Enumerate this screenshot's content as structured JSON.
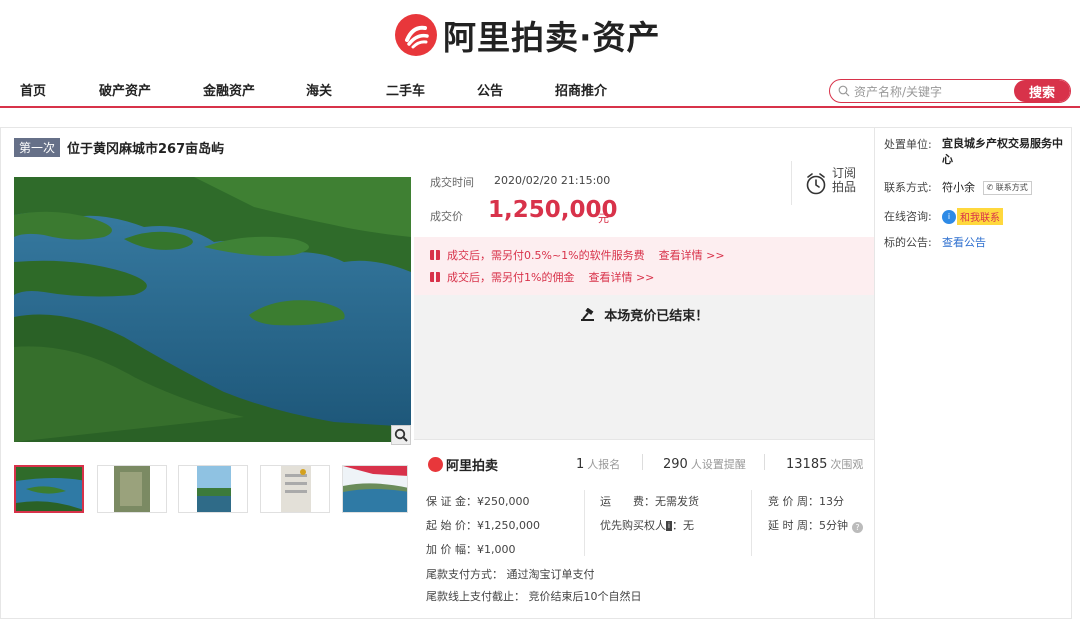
{
  "header": {
    "logo_text": "阿里拍卖·资产",
    "nav": [
      "首页",
      "破产资产",
      "金融资产",
      "海关",
      "二手车",
      "公告",
      "招商推介"
    ],
    "search_placeholder": "资产名称/关键字",
    "search_button": "搜索"
  },
  "item": {
    "round_tag": "第一次",
    "title": "位于黄冈麻城市267亩岛屿"
  },
  "deal": {
    "time_label": "成交时间",
    "time_value": "2020/02/20 21:15:00",
    "price_label": "成交价",
    "price_value": "1,250,000",
    "price_unit": "元",
    "subscribe_label": "订阅拍品",
    "notices": [
      {
        "text": "成交后，需另付0.5%~1%的软件服务费",
        "link": "查看详情 >>"
      },
      {
        "text": "成交后，需另付1%的佣金",
        "link": "查看详情 >>"
      }
    ],
    "ended_text": "本场竞价已结束！"
  },
  "stats": {
    "brand": "阿里拍卖",
    "signup_count": "1",
    "signup_label": "人报名",
    "reminder_count": "290",
    "reminder_label": "人设置提醒",
    "view_count": "13185",
    "view_label": "次围观"
  },
  "terms": {
    "deposit": "保 证 金：¥250,000",
    "start_price": "起 始 价：¥1,250,000",
    "increment": "加 价 幅：¥1,000",
    "shipping": "运　　费：无需发货",
    "priority": "优先购买权人",
    "priority_badge": "i",
    "priority_value": "：无",
    "bid_period": "竞 价 周：13分",
    "extend_period": "延 时 周：5分钟",
    "help_icon": "?",
    "final_pay_method": "尾款支付方式：  通过淘宝订单支付",
    "final_pay_deadline": "尾款线上支付截止：  竞价结束后10个自然日"
  },
  "sidebar": {
    "unit_label": "处置单位:",
    "unit_value": "宜良城乡产权交易服务中心",
    "contact_label": "联系方式:",
    "contact_name": "符小余",
    "contact_button": "联系方式",
    "consult_label": "在线咨询:",
    "consult_button": "和我联系",
    "consult_icon_text": "i",
    "notice_label": "标的公告:",
    "notice_link": "查看公告"
  },
  "icons": {
    "logo": "alipay-auction-logo-icon",
    "search": "search-icon",
    "zoom": "zoom-icon",
    "alarm": "alarm-clock-icon",
    "gavel": "gavel-icon",
    "gift": "gift-icon"
  },
  "colors": {
    "brand_red": "#d8324a",
    "logo_red": "#e8373b",
    "link_blue": "#2e6fcf"
  }
}
